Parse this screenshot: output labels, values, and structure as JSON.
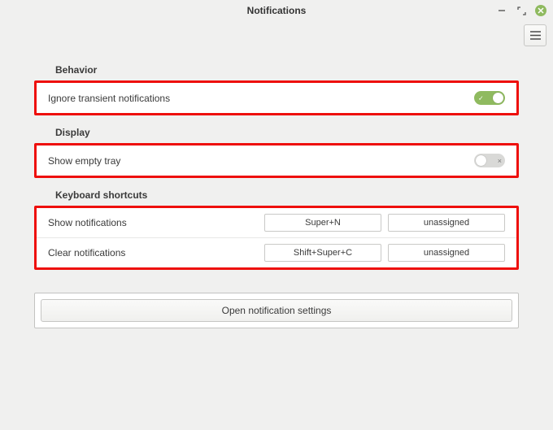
{
  "window": {
    "title": "Notifications"
  },
  "sections": {
    "behavior": {
      "title": "Behavior"
    },
    "display": {
      "title": "Display"
    },
    "shortcuts": {
      "title": "Keyboard shortcuts"
    }
  },
  "behavior": {
    "ignore_transient": {
      "label": "Ignore transient notifications",
      "value": true
    }
  },
  "display": {
    "show_empty_tray": {
      "label": "Show empty tray",
      "value": false
    }
  },
  "shortcuts": {
    "show": {
      "label": "Show notifications",
      "primary": "Super+N",
      "secondary": "unassigned"
    },
    "clear": {
      "label": "Clear notifications",
      "primary": "Shift+Super+C",
      "secondary": "unassigned"
    }
  },
  "actions": {
    "open_settings": "Open notification settings"
  },
  "colors": {
    "accent": "#8fba5f",
    "highlight_border": "#ee0f0c"
  }
}
